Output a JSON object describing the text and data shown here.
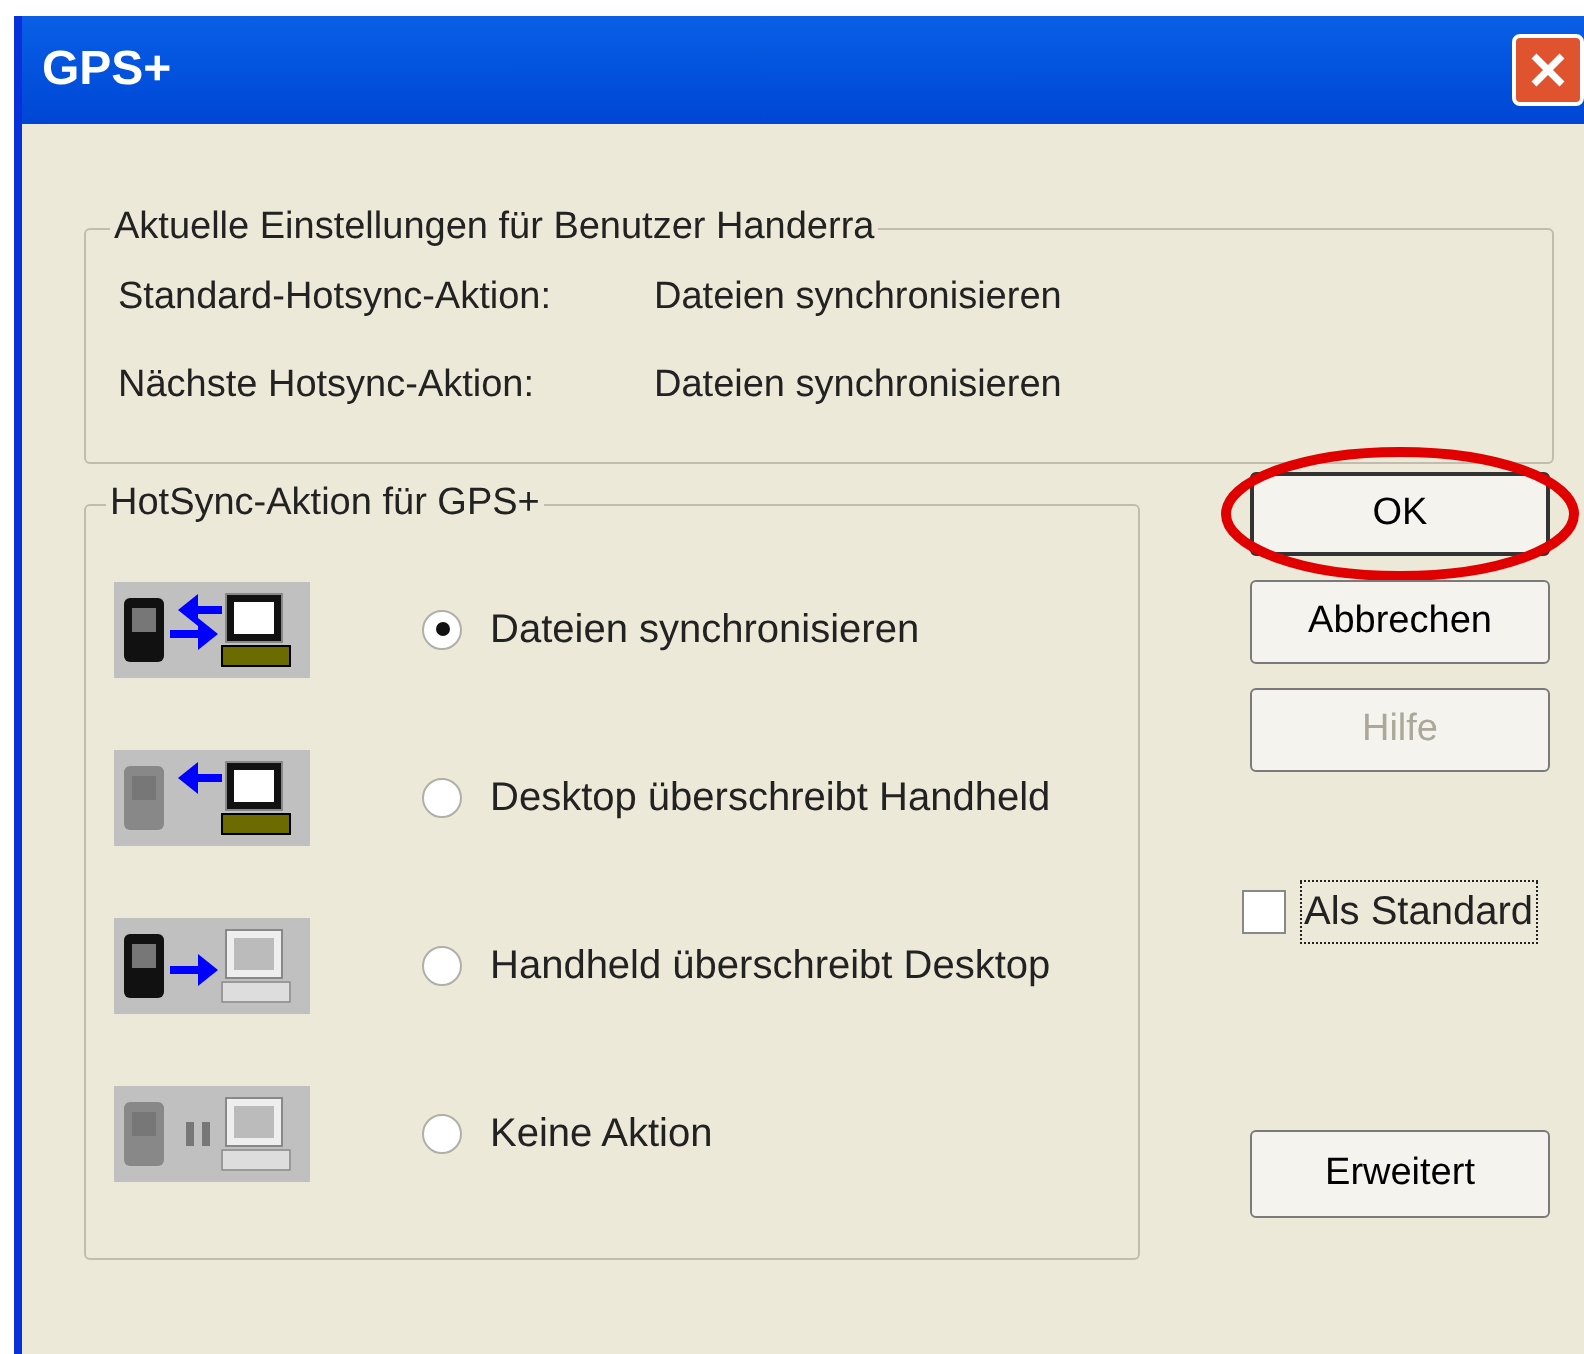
{
  "window": {
    "title": "GPS+"
  },
  "current_settings": {
    "title": "Aktuelle Einstellungen für Benutzer Handerra",
    "rows": [
      {
        "label": "Standard-Hotsync-Aktion:",
        "value": "Dateien synchronisieren"
      },
      {
        "label": "Nächste Hotsync-Aktion:",
        "value": "Dateien synchronisieren"
      }
    ]
  },
  "hotsync_action": {
    "title": "HotSync-Aktion für GPS+",
    "options": [
      {
        "kind": "sync",
        "label": "Dateien synchronisieren",
        "selected": true
      },
      {
        "kind": "desktop_to_handheld",
        "label": "Desktop überschreibt Handheld",
        "selected": false
      },
      {
        "kind": "handheld_to_desktop",
        "label": "Handheld überschreibt Desktop",
        "selected": false
      },
      {
        "kind": "none",
        "label": "Keine Aktion",
        "selected": false
      }
    ]
  },
  "buttons": [
    {
      "label": "OK",
      "disabled": false,
      "default": true,
      "circled": true
    },
    {
      "label": "Abbrechen",
      "disabled": false,
      "default": false,
      "circled": false
    },
    {
      "label": "Hilfe",
      "disabled": true,
      "default": false,
      "circled": false
    }
  ],
  "as_default": {
    "label": "Als Standard",
    "checked": false,
    "focused": true
  },
  "advanced_button": {
    "label": "Erweitert",
    "disabled": false
  }
}
